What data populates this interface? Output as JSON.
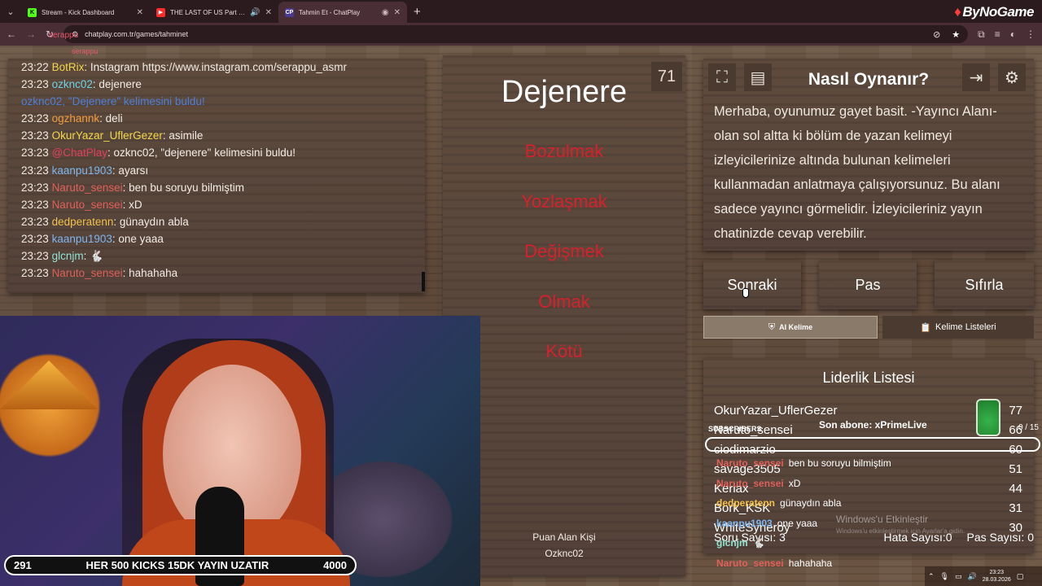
{
  "browser": {
    "tabs": [
      {
        "title": "Stream - Kick Dashboard",
        "favicon_color": "#53fc18"
      },
      {
        "title": "THE LAST OF US Part II Am",
        "favicon_color": "#ff2a2a"
      },
      {
        "title": "Tahmin Et - ChatPlay",
        "favicon_color": "#4b3a8f",
        "active": true
      }
    ],
    "url": "chatplay.com.tr/games/tahminet",
    "brand": "ByNoGame"
  },
  "ghost_text": {
    "user": "serappu",
    "user2": "serappu"
  },
  "chat": {
    "lines": [
      {
        "time": "23:22",
        "user": "BotRix",
        "user_color": "#f3d64a",
        "text": ": Instagram https://www.instagram.com/serappu_asmr"
      },
      {
        "time": "23:23",
        "user": "ozknc02",
        "user_color": "#6fd3e8",
        "text": ": dejenere"
      },
      {
        "time": "",
        "user": "",
        "user_color": "#4d7fd8",
        "text": "ozknc02, \"Dejenere\" kelimesini buldu!",
        "notice": true
      },
      {
        "time": "23:23",
        "user": "ogzhannk",
        "user_color": "#f39c3c",
        "text": ": deli"
      },
      {
        "time": "23:23",
        "user": "OkurYazar_UflerGezer",
        "user_color": "#f3d64a",
        "text": ": asimile"
      },
      {
        "time": "23:23",
        "user": "@ChatPlay",
        "user_color": "#e0405a",
        "text": ": ozknc02, \"dejenere\" kelimesini buldu!"
      },
      {
        "time": "23:23",
        "user": "kaanpu1903",
        "user_color": "#7fb6ef",
        "text": ": ayarsı"
      },
      {
        "time": "23:23",
        "user": "Naruto_sensei",
        "user_color": "#e0605a",
        "text": ": ben bu soruyu bilmiştim"
      },
      {
        "time": "23:23",
        "user": "Naruto_sensei",
        "user_color": "#e0605a",
        "text": ": xD"
      },
      {
        "time": "23:23",
        "user": "dedperatenn",
        "user_color": "#f3c24a",
        "text": ": günaydın abla"
      },
      {
        "time": "23:23",
        "user": "kaanpu1903",
        "user_color": "#7fb6ef",
        "text": ": one yaaa"
      },
      {
        "time": "23:23",
        "user": "glcnjm",
        "user_color": "#8fe3d0",
        "text": ": 🐇"
      },
      {
        "time": "23:23",
        "user": "Naruto_sensei",
        "user_color": "#e0605a",
        "text": ": hahahaha"
      }
    ]
  },
  "game": {
    "word": "Dejenere",
    "counter": "71",
    "forbidden": [
      "Bozulmak",
      "Yozlaşmak",
      "Değişmek",
      "Olmak",
      "Kötü"
    ],
    "scorer_label": "Puan Alan Kişi",
    "scorer_name": "Ozknc02"
  },
  "howto": {
    "title": "Nasıl Oynanır?",
    "text": "Merhaba, oyunumuz gayet basit. -Yayıncı Alanı- olan sol altta ki bölüm de yazan kelimeyi izleyicilerinize altında bulunan kelimeleri kullanmadan anlatmaya çalışıyorsunuz. Bu alanı sadece yayıncı görmelidir. İzleyicileriniz yayın chatinizde cevap verebilir."
  },
  "controls": {
    "next": "Sonraki",
    "pass": "Pas",
    "reset": "Sıfırla",
    "ai_word": "AI Kelime",
    "word_lists": "Kelime Listeleri"
  },
  "leaderboard": {
    "title": "Liderlik Listesi",
    "rows": [
      {
        "name": "OkurYazar_UflerGezer",
        "score": "77"
      },
      {
        "name": "Naruto_sensei",
        "score": "66"
      },
      {
        "name": "ciodimarzio",
        "score": "60"
      },
      {
        "name": "savage3505",
        "score": "51"
      },
      {
        "name": "Keriax",
        "score": "44"
      },
      {
        "name": "Bork_KSK",
        "score": "31"
      },
      {
        "name": "WhiteSyneroy",
        "score": "30"
      }
    ],
    "questions": "Soru Sayısı: 3",
    "errors": "Hata Sayısı:0",
    "passes": "Pas Sayısı: 0"
  },
  "overlay": {
    "subs_label": "SUBSCRIBERS",
    "last_sub": "Son abone: xPrimeLive",
    "subs_count": "0 / 15",
    "chat": [
      {
        "user": "Naruto_sensei",
        "color": "#e0605a",
        "text": "ben bu soruyu bilmiştim"
      },
      {
        "user": "Naruto_sensei",
        "color": "#e0605a",
        "text": "xD"
      },
      {
        "user": "dedperatenn",
        "color": "#f3c24a",
        "text": "günaydın abla"
      },
      {
        "user": "kaanpu1903",
        "color": "#7fb6ef",
        "text": "one yaaa"
      },
      {
        "user": "glcnjm",
        "color": "#8fe3d0",
        "text": "🐇"
      },
      {
        "user": "Naruto_sensei",
        "color": "#e0605a",
        "text": "hahahaha"
      }
    ],
    "watermark": "Windows'u Etkinleştir",
    "watermark_sub": "Windows'u etkinleştirmek için Ayarlar'a gidin."
  },
  "kicks_bar": {
    "left": "291",
    "text": "HER 500 KICKS 15DK YAYIN UZATIR",
    "right": "4000"
  },
  "taskbar": {
    "time": "23:23",
    "date": "28.03.2026"
  }
}
